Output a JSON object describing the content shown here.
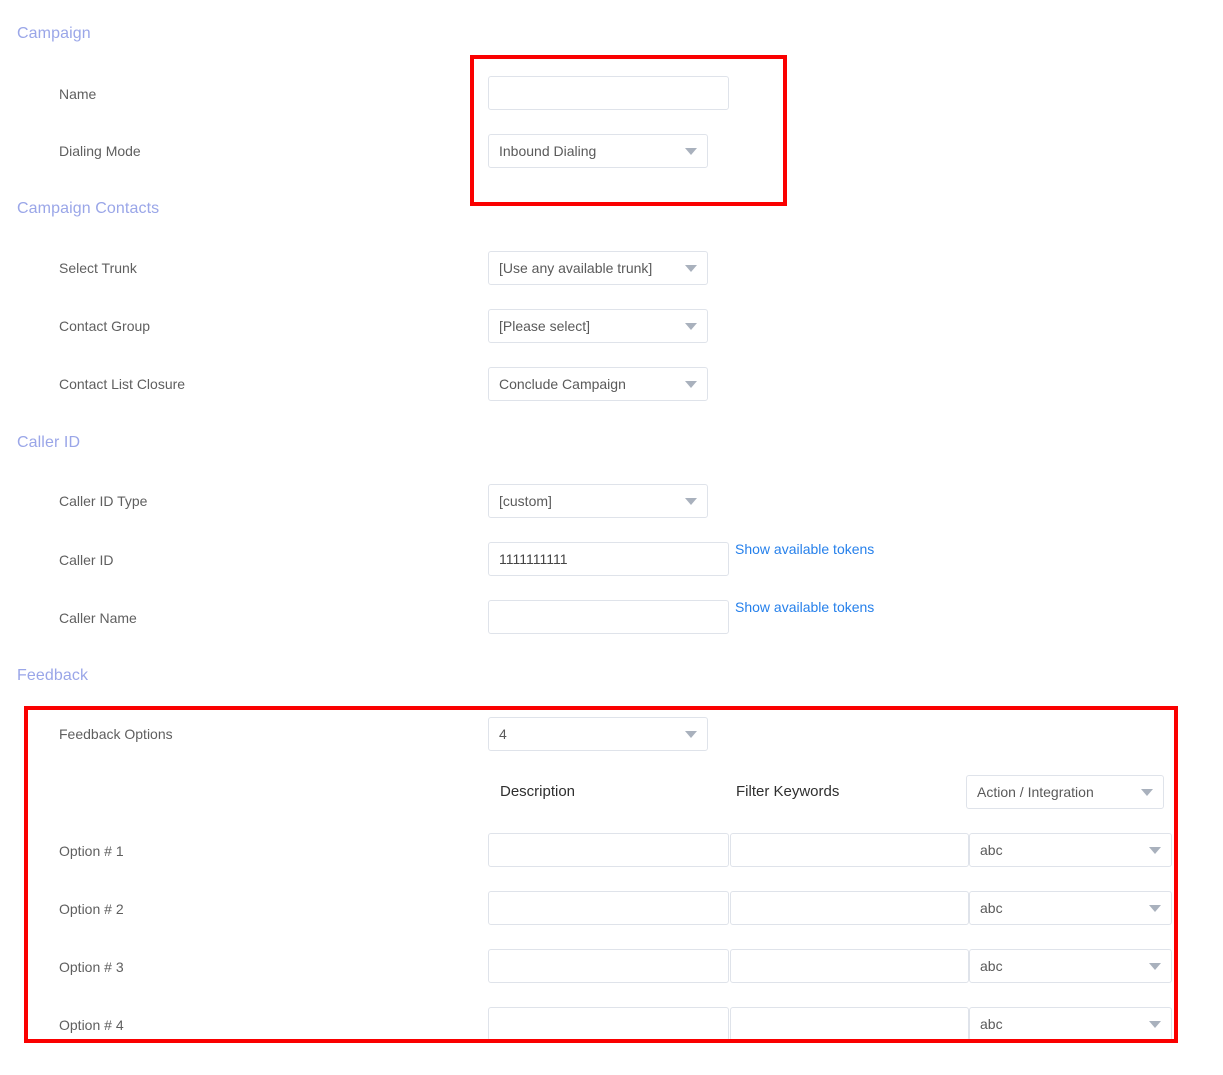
{
  "sections": {
    "campaign": {
      "title": "Campaign",
      "fields": [
        {
          "label": "Name",
          "type": "text",
          "value": "",
          "placeholder": ""
        },
        {
          "label": "Dialing Mode",
          "type": "select",
          "value": "Inbound Dialing"
        }
      ]
    },
    "campaign_contacts": {
      "title": "Campaign Contacts",
      "fields": [
        {
          "label": "Select Trunk",
          "type": "select",
          "value": "[Use any available trunk]"
        },
        {
          "label": "Contact Group",
          "type": "select",
          "value": "[Please select]"
        },
        {
          "label": "Contact List Closure",
          "type": "select",
          "value": "Conclude Campaign"
        }
      ]
    },
    "caller_id": {
      "title": "Caller ID",
      "fields": [
        {
          "label": "Caller ID Type",
          "type": "select",
          "value": "[custom]"
        },
        {
          "label": "Caller ID",
          "type": "text",
          "value": "1111111111",
          "link": "Show available tokens"
        },
        {
          "label": "Caller Name",
          "type": "text",
          "value": "",
          "link": "Show available tokens"
        }
      ]
    },
    "feedback": {
      "title": "Feedback",
      "options_count_label": "Feedback Options",
      "options_count_value": "4",
      "columns": {
        "description": "Description",
        "filter_keywords": "Filter Keywords",
        "action_integration": "Action / Integration"
      },
      "rows": [
        {
          "label": "Option # 1",
          "description": "",
          "filter_keywords": "",
          "action": "abc"
        },
        {
          "label": "Option # 2",
          "description": "",
          "filter_keywords": "",
          "action": "abc"
        },
        {
          "label": "Option # 3",
          "description": "",
          "filter_keywords": "",
          "action": "abc"
        },
        {
          "label": "Option # 4",
          "description": "",
          "filter_keywords": "",
          "action": "abc"
        }
      ]
    }
  },
  "annotations": {
    "highlight_color": "#fa0000",
    "boxes": [
      {
        "name": "campaign-fields-highlight"
      },
      {
        "name": "feedback-options-highlight"
      }
    ]
  },
  "colors": {
    "section_heading": "#9aa6e8",
    "label": "#5f5f5f",
    "link": "#2680eb",
    "input_border": "#dfe3ea",
    "highlight": "#fa0000"
  }
}
